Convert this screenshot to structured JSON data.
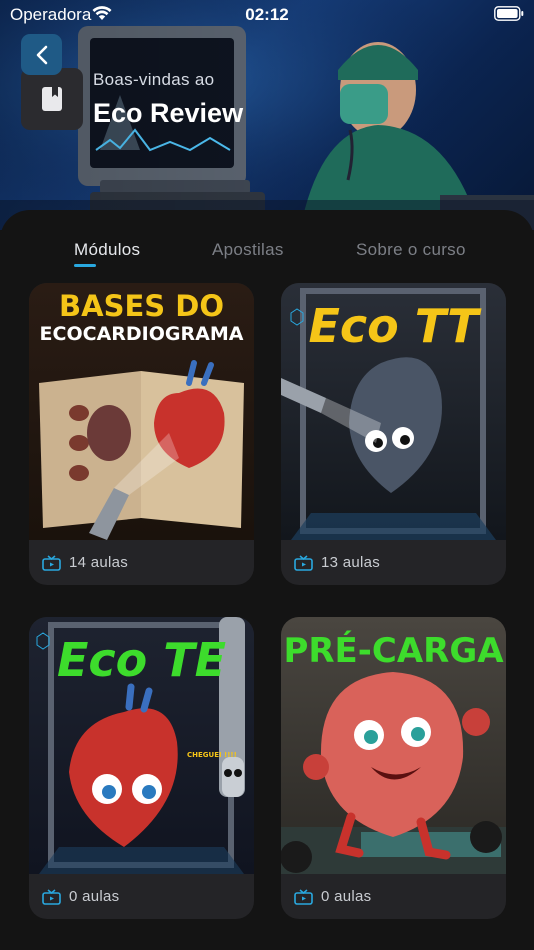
{
  "status_bar": {
    "carrier": "Operadora",
    "time": "02:12"
  },
  "header": {
    "back_icon": "chevron-left-icon",
    "course_icon": "book-icon",
    "welcome": "Boas-vindas ao",
    "title": "Eco Review"
  },
  "tabs": [
    {
      "label": "Módulos",
      "active": true
    },
    {
      "label": "Apostilas",
      "active": false
    },
    {
      "label": "Sobre o curso",
      "active": false
    }
  ],
  "modules": [
    {
      "title_line1": "BASES DO",
      "title_line2": "ECOCARDIOGRAMA",
      "lessons": "14 aulas"
    },
    {
      "title_line1": "Eco TT",
      "lessons": "13 aulas"
    },
    {
      "title_line1": "Eco TE",
      "caption": "CHEGUEI !!!!",
      "lessons": "0 aulas"
    },
    {
      "title_line1": "PRÉ-CARGA",
      "lessons": "0 aulas"
    }
  ],
  "colors": {
    "accent": "#29a8df",
    "back_button": "#1f5a86",
    "card_bg": "#242427",
    "page_bg": "#141414"
  }
}
